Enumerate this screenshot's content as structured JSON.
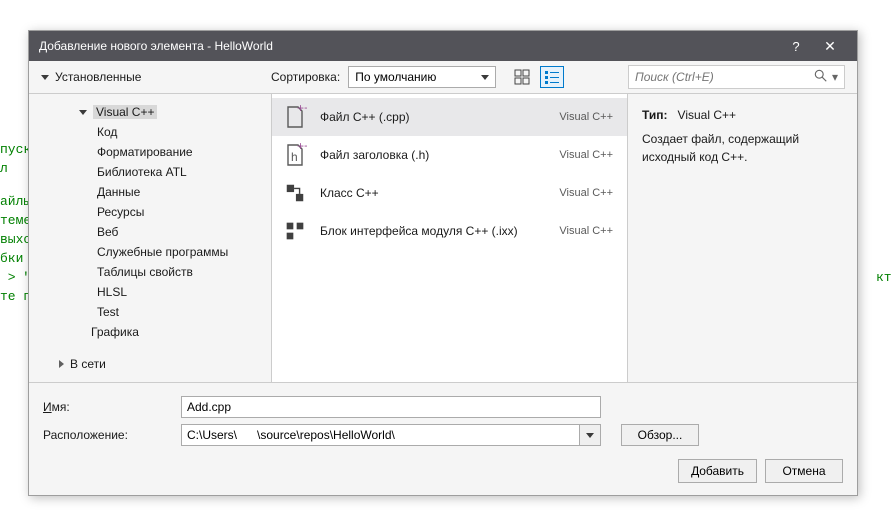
{
  "background": {
    "l1": "пуск\nл",
    "l2": "айлы\nтеме\nвыхо,\nбки\n > \"/\nте пу",
    "l3": "кт о"
  },
  "titlebar": {
    "title": "Добавление нового элемента  - HelloWorld"
  },
  "topstrip": {
    "installed_label": "Установленные",
    "sort_label": "Сортировка:",
    "sort_value": "По умолчанию",
    "search_placeholder": "Поиск (Ctrl+E)"
  },
  "tree": {
    "visual_cpp": "Visual C++",
    "items": [
      "Код",
      "Форматирование",
      "Библиотека ATL",
      "Данные",
      "Ресурсы",
      "Веб",
      "Служебные программы",
      "Таблицы свойств",
      "HLSL",
      "Test"
    ],
    "graphics": "Графика",
    "online": "В сети"
  },
  "templates": [
    {
      "name": "Файл C++ (.cpp)",
      "cat": "Visual C++",
      "selected": true
    },
    {
      "name": "Файл заголовка (.h)",
      "cat": "Visual C++",
      "selected": false
    },
    {
      "name": "Класс C++",
      "cat": "Visual C++",
      "selected": false
    },
    {
      "name": "Блок интерфейса модуля C++ (.ixx)",
      "cat": "Visual C++",
      "selected": false
    }
  ],
  "desc": {
    "type_label": "Тип:",
    "type_value": "Visual C++",
    "text": "Создает файл, содержащий исходный код C++."
  },
  "form": {
    "name_label_u": "И",
    "name_label_rest": "мя:",
    "name_value": "Add.cpp",
    "loc_label": "Расположение:",
    "loc_value_pre": "C:\\Users\\",
    "loc_value_post": "\\source\\repos\\HelloWorld\\",
    "browse_u": "О",
    "browse_rest": "бзор...",
    "add_u": "Д",
    "add_rest": "обавить",
    "cancel": "Отмена"
  }
}
